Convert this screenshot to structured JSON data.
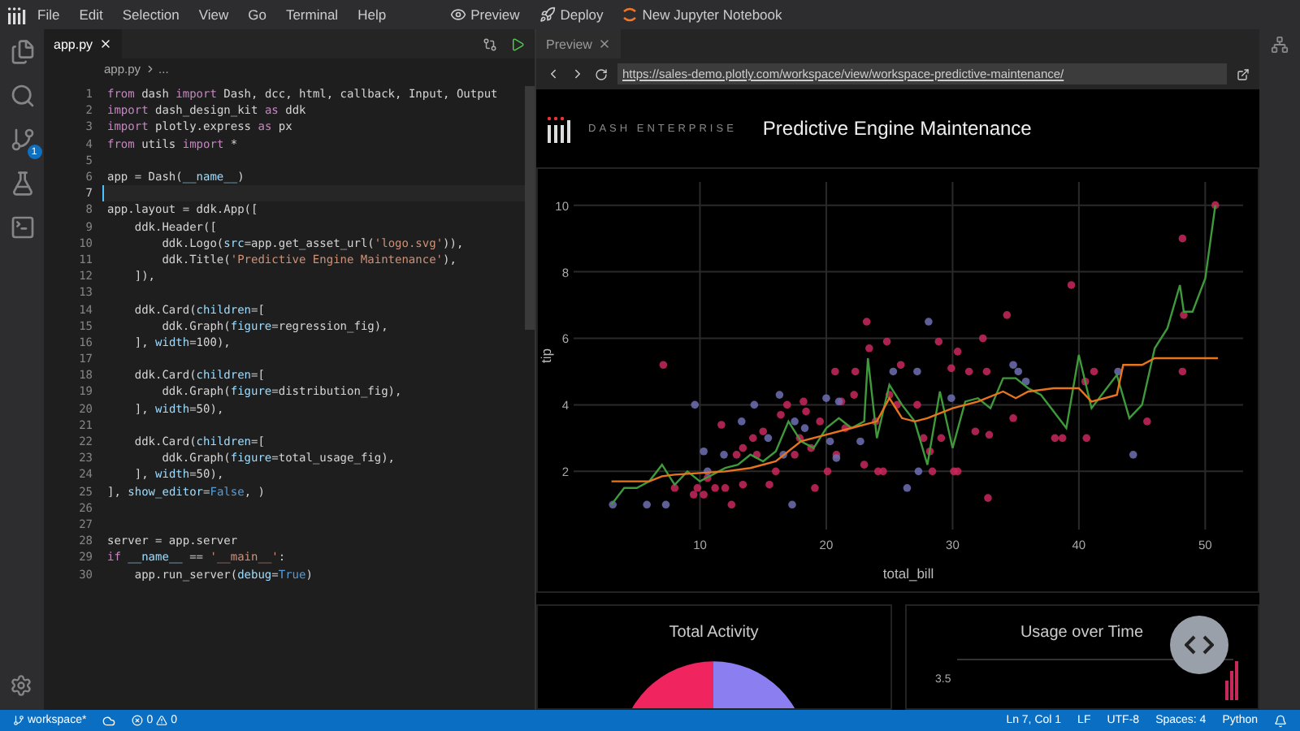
{
  "menu": {
    "items": [
      "File",
      "Edit",
      "Selection",
      "View",
      "Go",
      "Terminal",
      "Help"
    ],
    "actions": [
      {
        "kind": "preview",
        "label": "Preview"
      },
      {
        "kind": "deploy",
        "label": "Deploy"
      },
      {
        "kind": "notebook",
        "label": "New Jupyter Notebook"
      }
    ]
  },
  "activity_bar": {
    "source_control_badge": "1"
  },
  "editor": {
    "tab": "app.py",
    "breadcrumb": [
      "app.py",
      "..."
    ],
    "lines": [
      {
        "number": "1",
        "current": false,
        "tokens": [
          {
            "kind": "kw",
            "text": "from"
          },
          {
            "kind": "plain",
            "text": " dash "
          },
          {
            "kind": "kw",
            "text": "import"
          },
          {
            "kind": "plain",
            "text": " Dash, dcc, html, callback, Input, Output"
          }
        ]
      },
      {
        "number": "2",
        "current": false,
        "tokens": [
          {
            "kind": "kw",
            "text": "import"
          },
          {
            "kind": "plain",
            "text": " dash_design_kit "
          },
          {
            "kind": "kw",
            "text": "as"
          },
          {
            "kind": "plain",
            "text": " ddk"
          }
        ]
      },
      {
        "number": "3",
        "current": false,
        "tokens": [
          {
            "kind": "kw",
            "text": "import"
          },
          {
            "kind": "plain",
            "text": " plotly.express "
          },
          {
            "kind": "kw",
            "text": "as"
          },
          {
            "kind": "plain",
            "text": " px"
          }
        ]
      },
      {
        "number": "4",
        "current": false,
        "tokens": [
          {
            "kind": "kw",
            "text": "from"
          },
          {
            "kind": "plain",
            "text": " utils "
          },
          {
            "kind": "kw",
            "text": "import"
          },
          {
            "kind": "plain",
            "text": " *"
          }
        ]
      },
      {
        "number": "5",
        "current": false
      },
      {
        "number": "6",
        "current": false,
        "tokens": [
          {
            "kind": "plain",
            "text": "app = Dash("
          },
          {
            "kind": "param",
            "text": "__name__"
          },
          {
            "kind": "plain",
            "text": ")"
          }
        ]
      },
      {
        "number": "7",
        "current": true
      },
      {
        "number": "8",
        "current": false,
        "tokens": [
          {
            "kind": "plain",
            "text": "app.layout = ddk.App(["
          }
        ]
      },
      {
        "number": "9",
        "current": false,
        "tokens": [
          {
            "kind": "plain",
            "text": "    ddk.Header(["
          }
        ]
      },
      {
        "number": "10",
        "current": false,
        "tokens": [
          {
            "kind": "plain",
            "text": "        ddk.Logo("
          },
          {
            "kind": "param",
            "text": "src"
          },
          {
            "kind": "plain",
            "text": "=app.get_asset_url("
          },
          {
            "kind": "str",
            "text": "'logo.svg'"
          },
          {
            "kind": "plain",
            "text": ")),"
          }
        ]
      },
      {
        "number": "11",
        "current": false,
        "tokens": [
          {
            "kind": "plain",
            "text": "        ddk.Title("
          },
          {
            "kind": "str",
            "text": "'Predictive Engine Maintenance'"
          },
          {
            "kind": "plain",
            "text": "),"
          }
        ]
      },
      {
        "number": "12",
        "current": false,
        "tokens": [
          {
            "kind": "plain",
            "text": "    ]),"
          }
        ]
      },
      {
        "number": "13",
        "current": false
      },
      {
        "number": "14",
        "current": false,
        "tokens": [
          {
            "kind": "plain",
            "text": "    ddk.Card("
          },
          {
            "kind": "param",
            "text": "children"
          },
          {
            "kind": "plain",
            "text": "=["
          }
        ]
      },
      {
        "number": "15",
        "current": false,
        "tokens": [
          {
            "kind": "plain",
            "text": "        ddk.Graph("
          },
          {
            "kind": "param",
            "text": "figure"
          },
          {
            "kind": "plain",
            "text": "=regression_fig),"
          }
        ]
      },
      {
        "number": "16",
        "current": false,
        "tokens": [
          {
            "kind": "plain",
            "text": "    ], "
          },
          {
            "kind": "param",
            "text": "width"
          },
          {
            "kind": "plain",
            "text": "=100),"
          }
        ]
      },
      {
        "number": "17",
        "current": false
      },
      {
        "number": "18",
        "current": false,
        "tokens": [
          {
            "kind": "plain",
            "text": "    ddk.Card("
          },
          {
            "kind": "param",
            "text": "children"
          },
          {
            "kind": "plain",
            "text": "=["
          }
        ]
      },
      {
        "number": "19",
        "current": false,
        "tokens": [
          {
            "kind": "plain",
            "text": "        ddk.Graph("
          },
          {
            "kind": "param",
            "text": "figure"
          },
          {
            "kind": "plain",
            "text": "=distribution_fig),"
          }
        ]
      },
      {
        "number": "20",
        "current": false,
        "tokens": [
          {
            "kind": "plain",
            "text": "    ], "
          },
          {
            "kind": "param",
            "text": "width"
          },
          {
            "kind": "plain",
            "text": "=50),"
          }
        ]
      },
      {
        "number": "21",
        "current": false
      },
      {
        "number": "22",
        "current": false,
        "tokens": [
          {
            "kind": "plain",
            "text": "    ddk.Card("
          },
          {
            "kind": "param",
            "text": "children"
          },
          {
            "kind": "plain",
            "text": "=["
          }
        ]
      },
      {
        "number": "23",
        "current": false,
        "tokens": [
          {
            "kind": "plain",
            "text": "        ddk.Graph("
          },
          {
            "kind": "param",
            "text": "figure"
          },
          {
            "kind": "plain",
            "text": "=total_usage_fig),"
          }
        ]
      },
      {
        "number": "24",
        "current": false,
        "tokens": [
          {
            "kind": "plain",
            "text": "    ], "
          },
          {
            "kind": "param",
            "text": "width"
          },
          {
            "kind": "plain",
            "text": "=50),"
          }
        ]
      },
      {
        "number": "25",
        "current": false,
        "tokens": [
          {
            "kind": "plain",
            "text": "], "
          },
          {
            "kind": "param",
            "text": "show_editor"
          },
          {
            "kind": "plain",
            "text": "="
          },
          {
            "kind": "const",
            "text": "False"
          },
          {
            "kind": "plain",
            "text": ", )"
          }
        ]
      },
      {
        "number": "26",
        "current": false
      },
      {
        "number": "27",
        "current": false
      },
      {
        "number": "28",
        "current": false,
        "tokens": [
          {
            "kind": "plain",
            "text": "server = app.server"
          }
        ]
      },
      {
        "number": "29",
        "current": false,
        "tokens": [
          {
            "kind": "kw",
            "text": "if"
          },
          {
            "kind": "param",
            "text": " __name__"
          },
          {
            "kind": "plain",
            "text": " == "
          },
          {
            "kind": "str",
            "text": "'__main__'"
          },
          {
            "kind": "plain",
            "text": ":"
          }
        ]
      },
      {
        "number": "30",
        "current": false,
        "tokens": [
          {
            "kind": "plain",
            "text": "    app.run_server("
          },
          {
            "kind": "param",
            "text": "debug"
          },
          {
            "kind": "plain",
            "text": "="
          },
          {
            "kind": "const",
            "text": "True"
          },
          {
            "kind": "plain",
            "text": ")"
          }
        ]
      }
    ]
  },
  "preview": {
    "tab": "Preview",
    "url": "https://sales-demo.plotly.com/workspace/view/workspace-predictive-maintenance/",
    "app": {
      "brand": "DASH ENTERPRISE",
      "title": "Predictive Engine Maintenance",
      "regression": {
        "chart_data": {
          "type": "scatter",
          "xlabel": "total_bill",
          "ylabel": "tip",
          "xlim": [
            0,
            53
          ],
          "ylim": [
            0.25,
            10.7
          ],
          "xticks": [
            10,
            20,
            30,
            40,
            50
          ],
          "yticks": [
            2,
            4,
            6,
            8,
            10
          ],
          "grid": true,
          "series": [
            {
              "color": "#c8285a",
              "x": [
                7.1,
                8,
                9.5,
                9.8,
                10.3,
                10.6,
                11.2,
                11.7,
                12,
                12.5,
                12.9,
                13.4,
                13.4,
                14.2,
                14.5,
                15,
                15.5,
                16,
                16.4,
                16.9,
                17.5,
                17.9,
                18.2,
                18.4,
                18.8,
                19.1,
                19.5,
                20.1,
                20.7,
                20.8,
                21.2,
                21.5,
                22.2,
                22.3,
                23,
                23.2,
                23.4,
                23.9,
                24.1,
                24.5,
                24.8,
                25,
                25.6,
                25.9,
                27.2,
                27.7,
                28.2,
                28.4,
                28.9,
                29.1,
                29.9,
                30.1,
                30.4,
                30.4,
                31.3,
                31.8,
                32.4,
                32.7,
                32.8,
                32.9,
                34.3,
                34.8,
                38.1,
                38.7,
                39.4,
                40.5,
                40.6,
                41.2,
                45.4,
                48.2,
                48.2,
                48.3,
                50.8
              ],
              "values": [
                5.2,
                1.5,
                1.3,
                1.5,
                1.3,
                1.8,
                1.5,
                3.4,
                1.5,
                1,
                2.5,
                2.7,
                1.6,
                3,
                2.5,
                3.2,
                1.6,
                2,
                3.7,
                4,
                2.5,
                3,
                4.1,
                3.8,
                2.7,
                1.5,
                3.5,
                2,
                5,
                2.5,
                4.1,
                3.3,
                4.3,
                5,
                2.2,
                6.5,
                5.7,
                3.5,
                2,
                2,
                5.9,
                4.3,
                4,
                5.2,
                4,
                3,
                2.6,
                2,
                5.9,
                3,
                5.1,
                2,
                5.6,
                2,
                5,
                3.2,
                6,
                5,
                1.2,
                3.1,
                6.7,
                3.6,
                3,
                3,
                7.6,
                4.7,
                3,
                5,
                3.5,
                5,
                9,
                6.7,
                10
              ]
            },
            {
              "color": "#6e6eb4",
              "x": [
                3.1,
                5.8,
                7.3,
                9.6,
                10.3,
                10.6,
                11.9,
                13.3,
                14.3,
                15.4,
                16.3,
                16.6,
                17.3,
                17.5,
                18.3,
                20,
                20.3,
                20.8,
                21,
                22.7,
                25.3,
                26.4,
                27.2,
                27.3,
                28.1,
                29.9,
                34.8,
                35.2,
                35.8,
                43.1,
                44.3
              ],
              "values": [
                1,
                1,
                1,
                4,
                2.6,
                2,
                2.5,
                3.5,
                4,
                3,
                4.3,
                2.5,
                1,
                3.5,
                3.3,
                4.2,
                2.9,
                2.4,
                4.1,
                2.9,
                5,
                1.5,
                5,
                2,
                6.5,
                4.2,
                5.2,
                5,
                4.7,
                5,
                2.5
              ]
            },
            {
              "type": "line",
              "color": "#3e9a3a",
              "x": [
                3,
                4,
                5,
                6,
                7,
                8,
                9,
                10,
                11,
                12,
                13,
                14,
                15,
                16,
                17,
                18,
                19,
                20,
                21,
                22,
                23,
                23.3,
                24,
                25,
                26,
                27,
                28,
                29,
                30,
                31,
                32,
                33,
                34,
                35,
                36,
                37,
                38,
                39,
                40,
                41,
                42,
                43,
                44,
                45,
                46,
                47,
                48,
                48.3,
                49,
                50,
                50.8
              ],
              "values": [
                1,
                1.5,
                1.5,
                1.7,
                2.2,
                1.6,
                2,
                1.7,
                1.9,
                2.1,
                2.2,
                2.5,
                2.3,
                2.6,
                3.5,
                2.9,
                2.7,
                3.3,
                3.6,
                3.3,
                3.5,
                5.4,
                3,
                4.6,
                4,
                3.5,
                2.2,
                4.4,
                2.7,
                4.1,
                4.2,
                3.9,
                4.8,
                4.8,
                4.5,
                4.3,
                3.8,
                3.3,
                5.5,
                3.9,
                4.4,
                4.9,
                3.6,
                4,
                5.7,
                6.3,
                7.6,
                6.8,
                6.8,
                7.8,
                10
              ]
            },
            {
              "type": "line",
              "color": "#e8741e",
              "x": [
                3,
                6,
                7,
                8,
                10,
                12,
                14,
                16,
                18,
                20,
                22,
                24,
                25,
                26,
                27,
                28,
                30,
                32,
                34,
                35,
                36,
                38,
                40,
                41,
                43,
                43.5,
                45,
                46,
                48,
                50,
                51
              ],
              "values": [
                1.7,
                1.7,
                1.85,
                1.9,
                1.95,
                2,
                2.1,
                2.3,
                2.9,
                3.1,
                3.3,
                3.5,
                4.2,
                3.6,
                3.5,
                3.6,
                3.9,
                4.1,
                4.4,
                4.2,
                4.4,
                4.5,
                4.5,
                4.1,
                4.3,
                5.2,
                5.2,
                5.4,
                5.4,
                5.4,
                5.4
              ]
            }
          ]
        }
      },
      "cards": [
        {
          "kind": "pie",
          "title": "Total Activity"
        },
        {
          "kind": "bars",
          "title": "Usage over Time",
          "tick": "3.5"
        }
      ]
    }
  },
  "status_bar": {
    "branch": "workspace*",
    "errors": "0",
    "warnings": "0",
    "right": [
      "Ln 7, Col 1",
      "LF",
      "UTF-8",
      "Spaces: 4",
      "Python"
    ]
  }
}
